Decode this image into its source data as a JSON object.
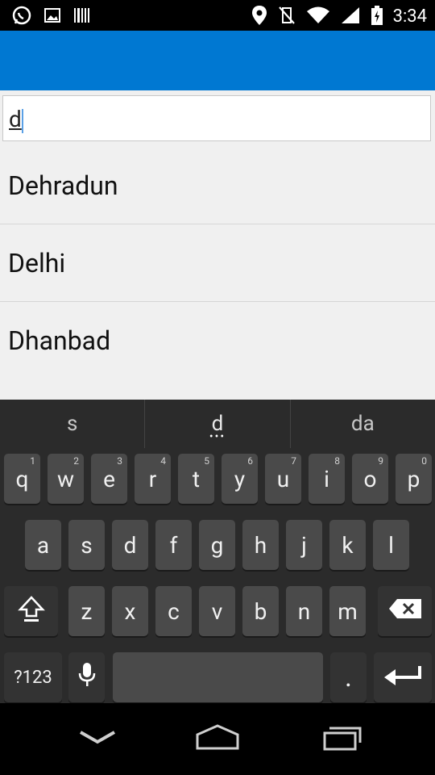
{
  "status_bar": {
    "time": "3:34"
  },
  "search": {
    "value": "d"
  },
  "results": [
    {
      "label": "Dehradun"
    },
    {
      "label": "Delhi"
    },
    {
      "label": "Dhanbad"
    }
  ],
  "keyboard": {
    "suggestions": [
      "s",
      "d",
      "da"
    ],
    "row1": [
      "q",
      "w",
      "e",
      "r",
      "t",
      "y",
      "u",
      "i",
      "o",
      "p"
    ],
    "row1_hints": [
      "1",
      "2",
      "3",
      "4",
      "5",
      "6",
      "7",
      "8",
      "9",
      "0"
    ],
    "row2": [
      "a",
      "s",
      "d",
      "f",
      "g",
      "h",
      "j",
      "k",
      "l"
    ],
    "row3": [
      "z",
      "x",
      "c",
      "v",
      "b",
      "n",
      "m"
    ],
    "symbols_label": "?123",
    "period_label": "."
  }
}
